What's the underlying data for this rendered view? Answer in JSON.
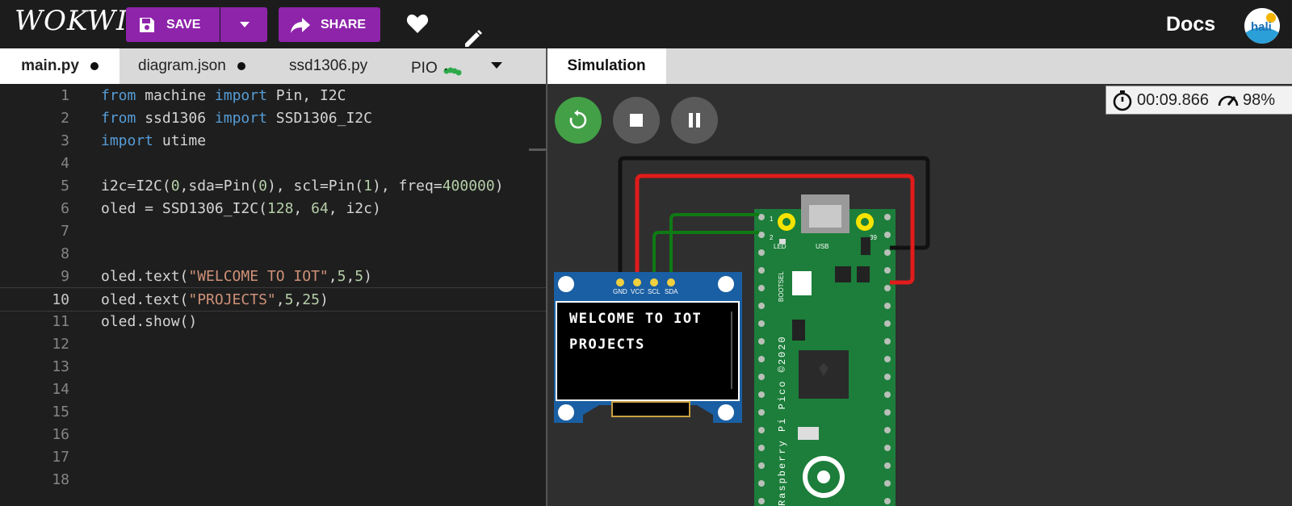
{
  "header": {
    "logo": "WOKWI",
    "save_label": "SAVE",
    "share_label": "SHARE",
    "docs_label": "Docs",
    "avatar_text": "hali",
    "brand_color": "#8e24aa"
  },
  "tabs": [
    {
      "label": "main.py",
      "modified": true,
      "active": true
    },
    {
      "label": "diagram.json",
      "modified": true,
      "active": false
    },
    {
      "label": "ssd1306.py",
      "modified": false,
      "active": false
    },
    {
      "label": "PIO",
      "modified": false,
      "active": false
    }
  ],
  "simulation_tab": "Simulation",
  "editor": {
    "current_line": 10,
    "line_numbers": [
      "1",
      "2",
      "3",
      "4",
      "5",
      "6",
      "7",
      "8",
      "9",
      "10",
      "11",
      "12",
      "13",
      "14",
      "15",
      "16",
      "17",
      "18"
    ]
  },
  "simulation": {
    "timer": "00:09.866",
    "speed": "98%",
    "oled_lines": [
      "WELCOME TO IOT",
      "PROJECTS"
    ],
    "oled_pins": [
      "GND",
      "VCC",
      "SCL",
      "SDA"
    ],
    "pico_labels": {
      "led": "LED",
      "usb": "USB",
      "bootsel": "BOOTSEL",
      "pin1": "1",
      "pin2": "2",
      "pin39": "39",
      "board": "Raspberry Pi Pico ©2020"
    }
  }
}
